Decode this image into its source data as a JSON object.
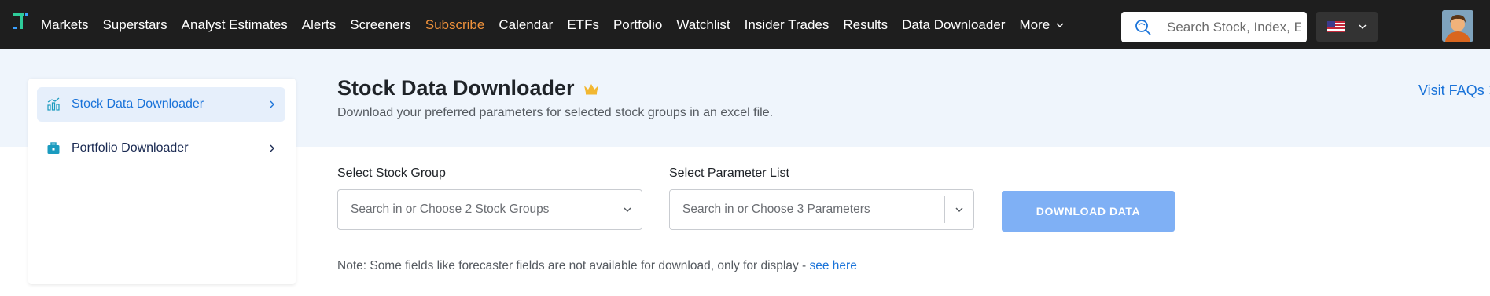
{
  "nav": {
    "items": [
      {
        "label": "Markets"
      },
      {
        "label": "Superstars"
      },
      {
        "label": "Analyst Estimates"
      },
      {
        "label": "Alerts"
      },
      {
        "label": "Screeners"
      },
      {
        "label": "Subscribe",
        "accent": true
      },
      {
        "label": "Calendar"
      },
      {
        "label": "ETFs"
      },
      {
        "label": "Portfolio"
      },
      {
        "label": "Watchlist"
      },
      {
        "label": "Insider Trades"
      },
      {
        "label": "Results"
      },
      {
        "label": "Data Downloader"
      },
      {
        "label": "More"
      }
    ],
    "search_placeholder": "Search Stock, Index, ETF",
    "country_icon": "us-flag-icon",
    "accent_color": "#f0923b"
  },
  "sidebar": {
    "items": [
      {
        "label": "Stock Data Downloader",
        "icon": "chart-icon",
        "active": true
      },
      {
        "label": "Portfolio Downloader",
        "icon": "briefcase-icon",
        "active": false
      }
    ]
  },
  "header": {
    "title": "Stock Data Downloader",
    "subtitle": "Download your preferred parameters for selected stock groups in an excel file.",
    "faq_link": "Visit FAQs"
  },
  "form": {
    "stock_group_label": "Select Stock Group",
    "stock_group_placeholder": "Search in or Choose 2 Stock Groups",
    "parameter_label": "Select Parameter List",
    "parameter_placeholder": "Search in or Choose 3 Parameters",
    "download_label": "DOWNLOAD DATA",
    "download_color": "#7fb0f5"
  },
  "note": {
    "text": "Note: Some fields like forecaster fields are not available for download, only for display - ",
    "link": "see here"
  }
}
